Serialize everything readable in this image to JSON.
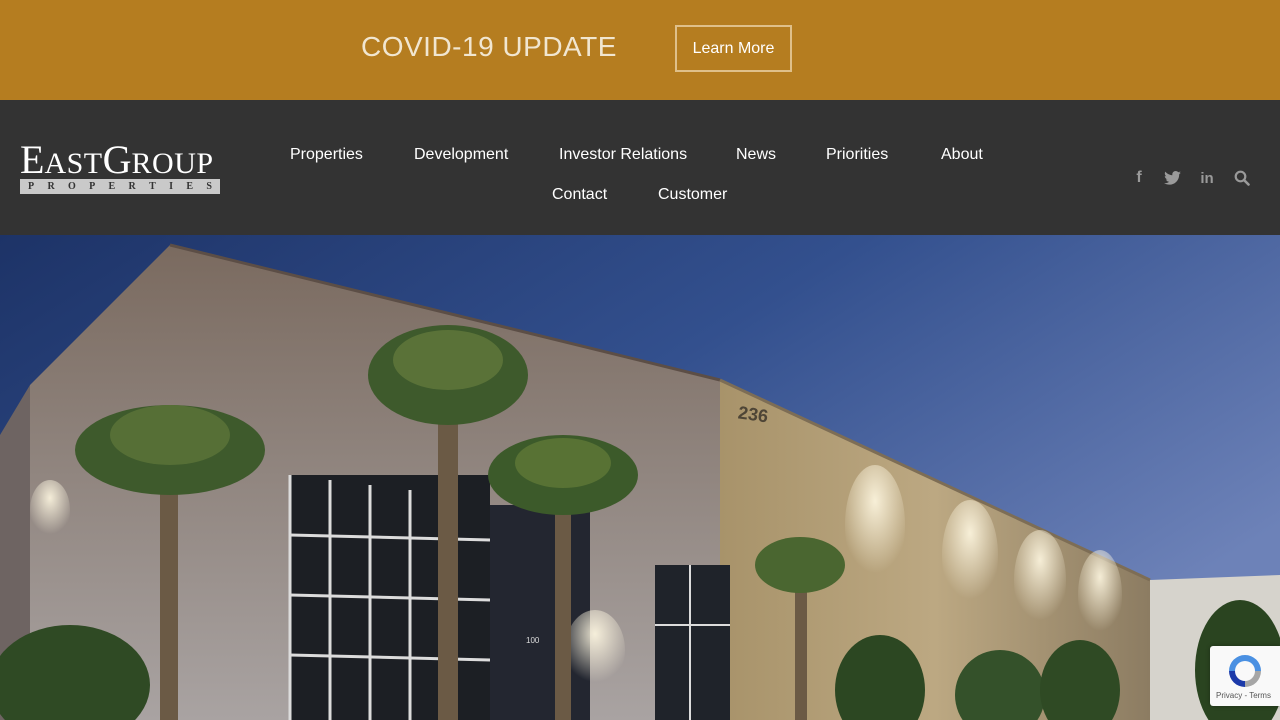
{
  "banner": {
    "title": "COVID-19 UPDATE",
    "button_label": "Learn More",
    "background_color": "#b57d20"
  },
  "logo": {
    "name_cap1": "E",
    "name_rest1": "AST",
    "name_cap2": "G",
    "name_rest2": "ROUP",
    "tagline_letters": [
      "P",
      "R",
      "O",
      "P",
      "E",
      "R",
      "T",
      "I",
      "E",
      "S"
    ]
  },
  "nav": {
    "items": [
      {
        "label": "Properties"
      },
      {
        "label": "Development"
      },
      {
        "label": "Investor Relations"
      },
      {
        "label": "News"
      },
      {
        "label": "Priorities"
      },
      {
        "label": "About"
      },
      {
        "label": "Contact"
      },
      {
        "label": "Customer"
      }
    ]
  },
  "social": {
    "facebook_glyph": "f",
    "linkedin_glyph": "in",
    "icons": [
      "facebook-icon",
      "twitter-icon",
      "linkedin-icon",
      "search-icon"
    ]
  },
  "hero": {
    "building_number": "236",
    "door_number": "100"
  },
  "recaptcha": {
    "terms": "Privacy - Terms"
  },
  "colors": {
    "header_bg": "#333333",
    "accent": "#b57d20"
  }
}
